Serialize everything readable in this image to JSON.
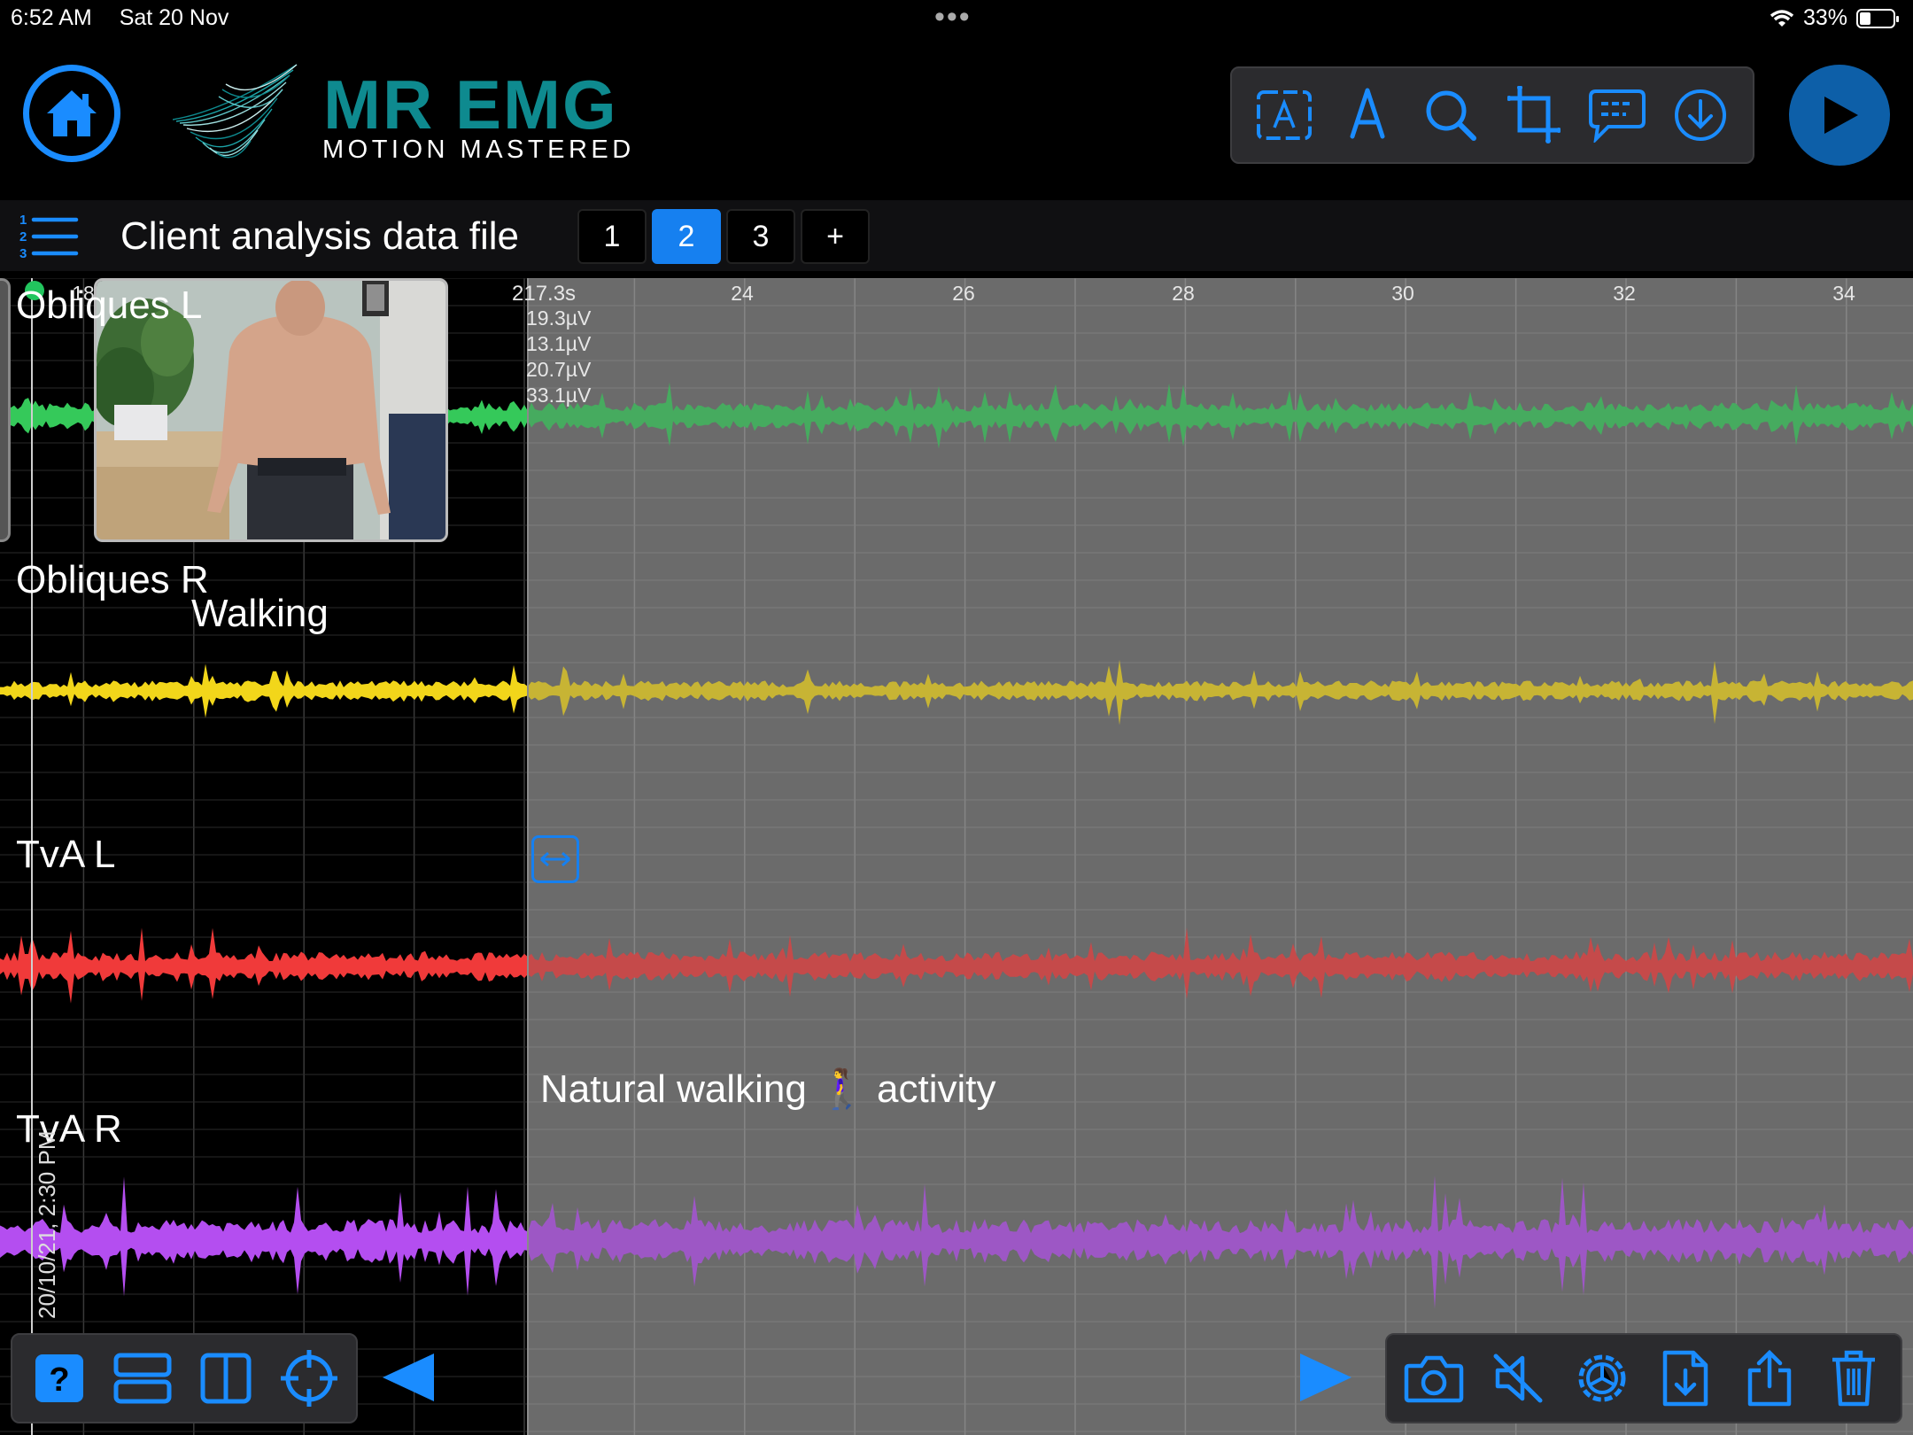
{
  "status_bar": {
    "time": "6:52 AM",
    "date": "Sat 20 Nov",
    "battery": "33%"
  },
  "header": {
    "logo_title": "MR EMG",
    "logo_subtitle": "MOTION MASTERED",
    "toolbar": [
      "text-box-icon",
      "pen-icon",
      "search-icon",
      "crop-icon",
      "comment-icon",
      "download-icon"
    ],
    "colors": {
      "accent": "#1680f0",
      "brand": "#0e8a8f"
    }
  },
  "file_bar": {
    "title": "Client analysis data file",
    "pages": [
      "1",
      "2",
      "3",
      "+"
    ],
    "active_page": "2"
  },
  "chart_data": {
    "type": "line",
    "x_ticks": [
      "18",
      "24",
      "26",
      "28",
      "30",
      "32",
      "34"
    ],
    "cursor_time": "217.3s",
    "readouts": [
      "19.3µV",
      "13.1µV",
      "20.7µV",
      "33.1µV"
    ],
    "series": [
      {
        "name": "Obliques L",
        "color": "#35c95a",
        "amplitude_uV": 19.3
      },
      {
        "name": "Obliques R",
        "color": "#f2d61a",
        "amplitude_uV": 13.1
      },
      {
        "name": "TvA L",
        "color": "#f03a3a",
        "amplitude_uV": 20.7
      },
      {
        "name": "TvA R",
        "color": "#b44ef0",
        "amplitude_uV": 33.1
      }
    ],
    "annotations": [
      "Walking",
      "Natural walking 🚶‍♀️ activity"
    ],
    "recording_date": "20/10/21, 2:30 PM",
    "grid": true
  },
  "bottom_bar": {
    "left": [
      "help-icon",
      "rows-layout-icon",
      "columns-layout-icon",
      "crosshair-icon"
    ],
    "right": [
      "camera-icon",
      "mute-icon",
      "settings-icon",
      "file-download-icon",
      "share-icon",
      "trash-icon"
    ]
  }
}
